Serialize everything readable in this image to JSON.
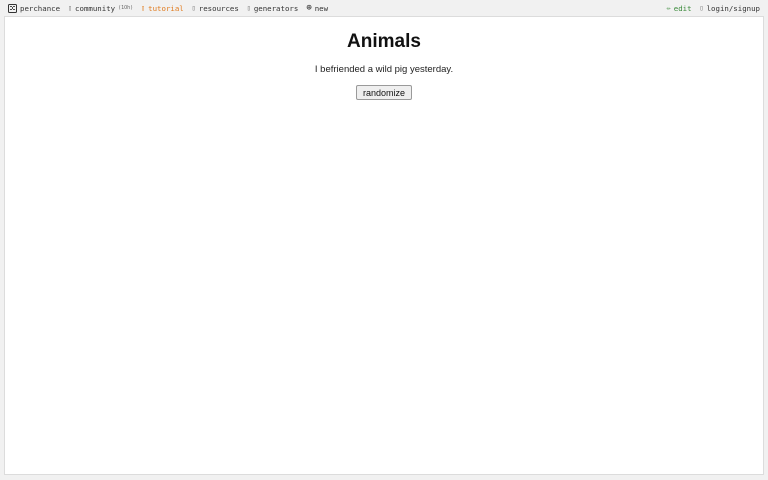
{
  "nav": {
    "brand": {
      "label": "perchance",
      "icon": "die-icon"
    },
    "community": {
      "label": "community",
      "count": "(1Oh)",
      "icon": "chat-icon"
    },
    "tutorial": {
      "label": "tutorial",
      "icon": "book-icon",
      "color": "#e07b1f"
    },
    "resources": {
      "label": "resources",
      "icon": "folder-icon"
    },
    "generators": {
      "label": "generators",
      "icon": "grid-icon"
    },
    "new": {
      "label": "new",
      "icon": "plus-circle-icon"
    },
    "edit": {
      "label": "edit",
      "icon": "pencil-icon",
      "color": "#3a8a3a"
    },
    "login": {
      "label": "login/signup",
      "icon": "user-icon"
    }
  },
  "generator": {
    "title": "Animals",
    "output": "I befriended a wild pig yesterday.",
    "button_label": "randomize"
  }
}
